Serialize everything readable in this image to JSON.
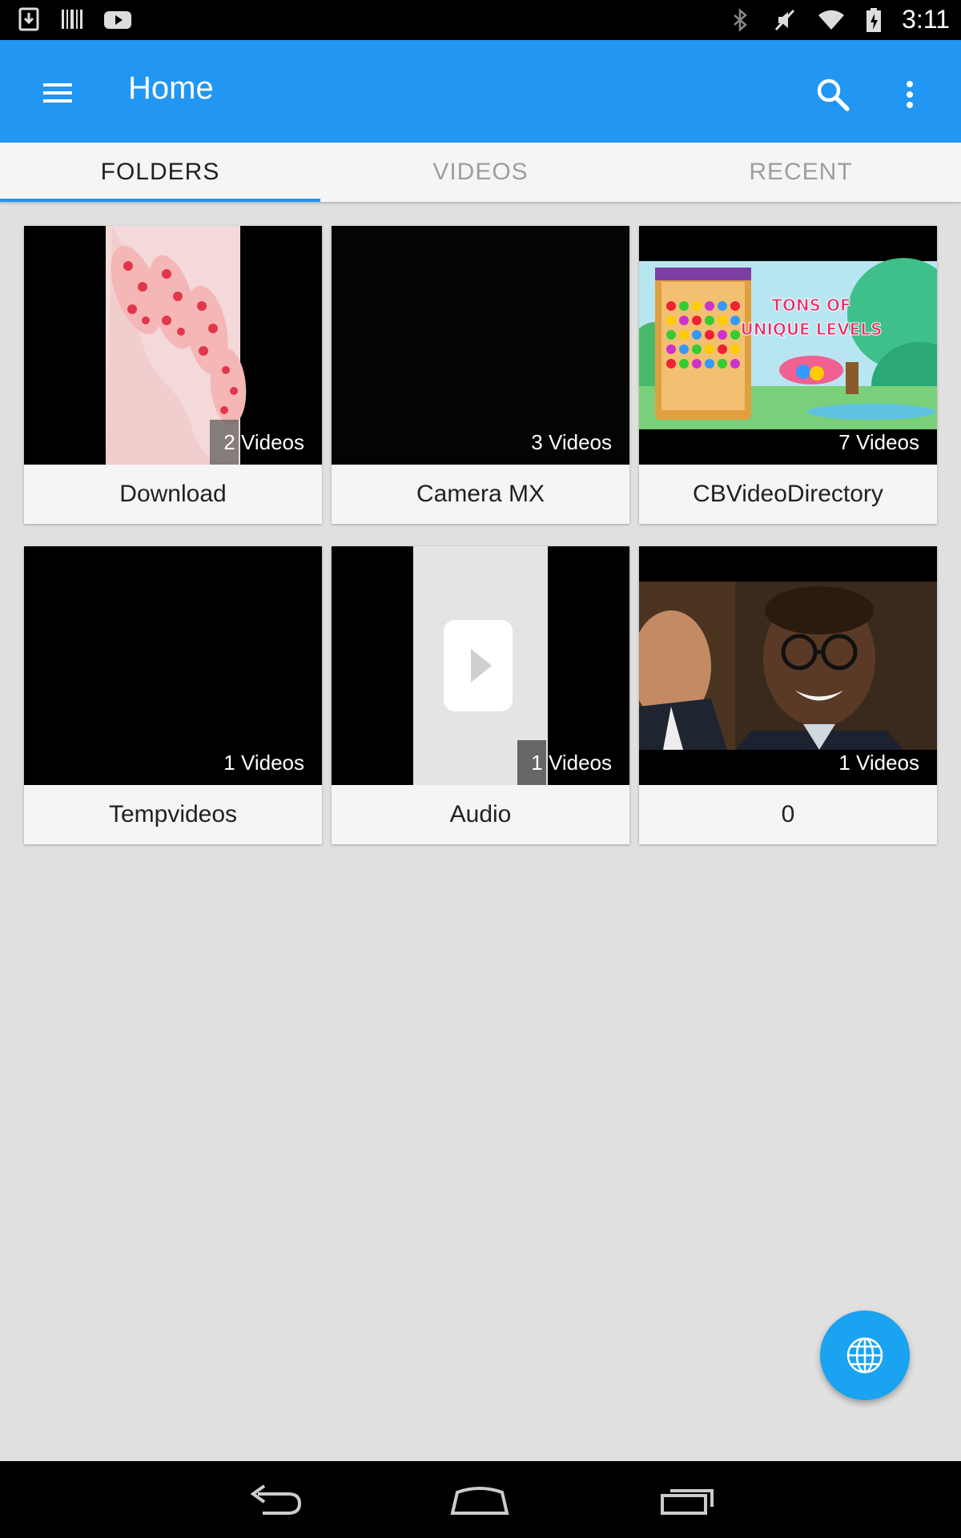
{
  "status_bar": {
    "time": "3:11",
    "left_icons": [
      "download-icon",
      "barcode-icon",
      "youtube-icon"
    ],
    "right_icons": [
      "bluetooth-icon",
      "muted-icon",
      "wifi-icon",
      "battery-charging-icon"
    ]
  },
  "app_bar": {
    "title": "Home",
    "menu_icon": "hamburger-menu-icon",
    "search_icon": "search-icon",
    "more_icon": "more-vert-icon",
    "color": "#2196f3"
  },
  "tabs": [
    {
      "label": "FOLDERS",
      "active": true
    },
    {
      "label": "VIDEOS",
      "active": false
    },
    {
      "label": "RECENT",
      "active": false
    }
  ],
  "folders": [
    {
      "name": "Download",
      "count": "2 Videos"
    },
    {
      "name": "Camera MX",
      "count": "3 Videos"
    },
    {
      "name": "CBVideoDirectory",
      "count": "7 Videos",
      "thumbnail_text": [
        "TONS OF",
        "UNIQUE LEVELS"
      ]
    },
    {
      "name": "Tempvideos",
      "count": "1 Videos"
    },
    {
      "name": "Audio",
      "count": "1 Videos"
    },
    {
      "name": "0",
      "count": "1 Videos"
    }
  ],
  "fab": {
    "icon": "globe-icon",
    "color": "#1aa3f0"
  },
  "nav_bar": {
    "icons": [
      "back-icon",
      "home-icon",
      "recents-icon"
    ]
  }
}
